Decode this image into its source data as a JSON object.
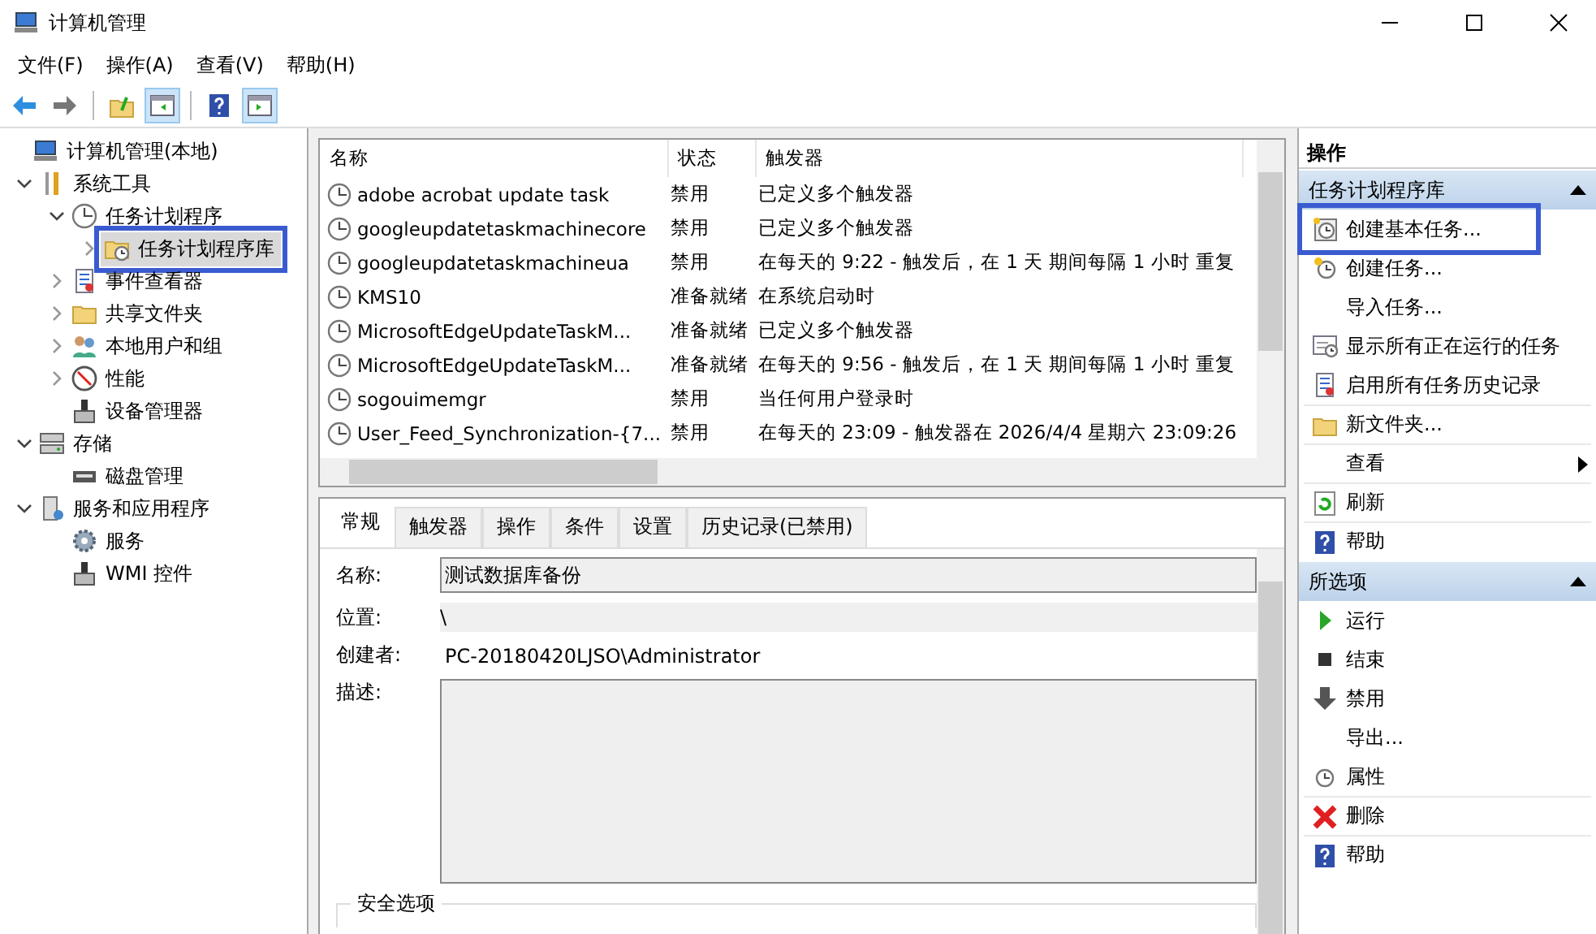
{
  "window": {
    "title": "计算机管理"
  },
  "menu": [
    "文件(F)",
    "操作(A)",
    "查看(V)",
    "帮助(H)"
  ],
  "toolbar": [
    {
      "kind": "back",
      "pressed": false
    },
    {
      "kind": "forward",
      "pressed": false
    },
    {
      "kind": "sep"
    },
    {
      "kind": "up",
      "pressed": false
    },
    {
      "kind": "tree-pane",
      "pressed": true
    },
    {
      "kind": "sep"
    },
    {
      "kind": "help",
      "pressed": false
    },
    {
      "kind": "action-pane",
      "pressed": true
    }
  ],
  "tree": [
    {
      "label": "计算机管理(本地)",
      "kind": "computer",
      "selected": false,
      "annotated": false,
      "children": [
        {
          "label": "系统工具",
          "kind": "tools",
          "expanded": true,
          "selected": false,
          "annotated": false,
          "children": [
            {
              "label": "任务计划程序",
              "kind": "clock",
              "expanded": true,
              "selected": false,
              "annotated": false,
              "children": [
                {
                  "label": "任务计划程序库",
                  "kind": "folder-clock",
                  "expanded": false,
                  "selected": true,
                  "annotated": true
                }
              ]
            },
            {
              "label": "事件查看器",
              "kind": "log",
              "expanded": false,
              "selected": false,
              "annotated": false
            },
            {
              "label": "共享文件夹",
              "kind": "folder",
              "expanded": false,
              "selected": false,
              "annotated": false
            },
            {
              "label": "本地用户和组",
              "kind": "users",
              "expanded": false,
              "selected": false,
              "annotated": false
            },
            {
              "label": "性能",
              "kind": "gauge",
              "expanded": false,
              "selected": false,
              "annotated": false
            },
            {
              "label": "设备管理器",
              "kind": "device",
              "selected": false,
              "annotated": false
            }
          ]
        },
        {
          "label": "存储",
          "kind": "storage",
          "expanded": true,
          "selected": false,
          "annotated": false,
          "children": [
            {
              "label": "磁盘管理",
              "kind": "disk",
              "selected": false,
              "annotated": false
            }
          ]
        },
        {
          "label": "服务和应用程序",
          "kind": "server",
          "expanded": true,
          "selected": false,
          "annotated": false,
          "children": [
            {
              "label": "服务",
              "kind": "gear",
              "selected": false,
              "annotated": false
            },
            {
              "label": "WMI 控件",
              "kind": "device",
              "selected": false,
              "annotated": false
            }
          ]
        }
      ]
    }
  ],
  "table": {
    "columns": [
      "名称",
      "状态",
      "触发器"
    ],
    "rows": [
      {
        "name": "adobe acrobat update task",
        "status": "禁用",
        "trigger": "已定义多个触发器"
      },
      {
        "name": "googleupdatetaskmachinecore",
        "status": "禁用",
        "trigger": "已定义多个触发器"
      },
      {
        "name": "googleupdatetaskmachineua",
        "status": "禁用",
        "trigger": "在每天的 9:22 - 触发后，在 1 天 期间每隔 1 小时 重复"
      },
      {
        "name": "KMS10",
        "status": "准备就绪",
        "trigger": "在系统启动时"
      },
      {
        "name": "MicrosoftEdgeUpdateTaskM...",
        "status": "准备就绪",
        "trigger": "已定义多个触发器"
      },
      {
        "name": "MicrosoftEdgeUpdateTaskM...",
        "status": "准备就绪",
        "trigger": "在每天的 9:56 - 触发后，在 1 天 期间每隔 1 小时 重复"
      },
      {
        "name": "sogouimemgr",
        "status": "禁用",
        "trigger": "当任何用户登录时"
      },
      {
        "name": "User_Feed_Synchronization-{7...",
        "status": "禁用",
        "trigger": "在每天的 23:09 - 触发器在 2026/4/4 星期六 23:09:26"
      }
    ]
  },
  "detail": {
    "tabs": [
      {
        "label": "常规",
        "selected": true
      },
      {
        "label": "触发器",
        "selected": false
      },
      {
        "label": "操作",
        "selected": false
      },
      {
        "label": "条件",
        "selected": false
      },
      {
        "label": "设置",
        "selected": false
      },
      {
        "label": "历史记录(已禁用)",
        "selected": false
      }
    ],
    "name_label": "名称:",
    "name_value": "测试数据库备份",
    "location_label": "位置:",
    "location_value": "\\",
    "author_label": "创建者:",
    "author_value": "PC-20180420LJSO\\Administrator",
    "description_label": "描述:",
    "security_label": "安全选项"
  },
  "actions": {
    "title": "操作",
    "sections": [
      {
        "title": "任务计划程序库",
        "expanded": true,
        "items": [
          {
            "label": "创建基本任务...",
            "kind": "wizard",
            "annotated": true,
            "separator": false,
            "submenu": false
          },
          {
            "label": "创建任务...",
            "kind": "new-task",
            "annotated": false,
            "separator": false,
            "submenu": false
          },
          {
            "label": "导入任务...",
            "kind": "plain",
            "annotated": false,
            "separator": false,
            "submenu": false
          },
          {
            "label": "显示所有正在运行的任务",
            "kind": "running",
            "annotated": false,
            "separator": false,
            "submenu": false
          },
          {
            "label": "启用所有任务历史记录",
            "kind": "log",
            "annotated": false,
            "separator": false,
            "submenu": false
          },
          {
            "label": "新文件夹...",
            "kind": "folder",
            "annotated": false,
            "separator": true,
            "submenu": false
          },
          {
            "label": "查看",
            "kind": "plain",
            "annotated": false,
            "separator": true,
            "submenu": true
          },
          {
            "label": "刷新",
            "kind": "refresh",
            "annotated": false,
            "separator": true,
            "submenu": false
          },
          {
            "label": "帮助",
            "kind": "help",
            "annotated": false,
            "separator": true,
            "submenu": false
          }
        ]
      },
      {
        "title": "所选项",
        "expanded": true,
        "items": [
          {
            "label": "运行",
            "kind": "run",
            "annotated": false,
            "separator": false,
            "submenu": false
          },
          {
            "label": "结束",
            "kind": "stop",
            "annotated": false,
            "separator": false,
            "submenu": false
          },
          {
            "label": "禁用",
            "kind": "disable",
            "annotated": false,
            "separator": false,
            "submenu": false
          },
          {
            "label": "导出...",
            "kind": "plain",
            "annotated": false,
            "separator": false,
            "submenu": false
          },
          {
            "label": "属性",
            "kind": "properties",
            "annotated": false,
            "separator": false,
            "submenu": false
          },
          {
            "label": "删除",
            "kind": "delete",
            "annotated": false,
            "separator": true,
            "submenu": false
          },
          {
            "label": "帮助",
            "kind": "help",
            "annotated": false,
            "separator": true,
            "submenu": false
          }
        ]
      }
    ]
  }
}
